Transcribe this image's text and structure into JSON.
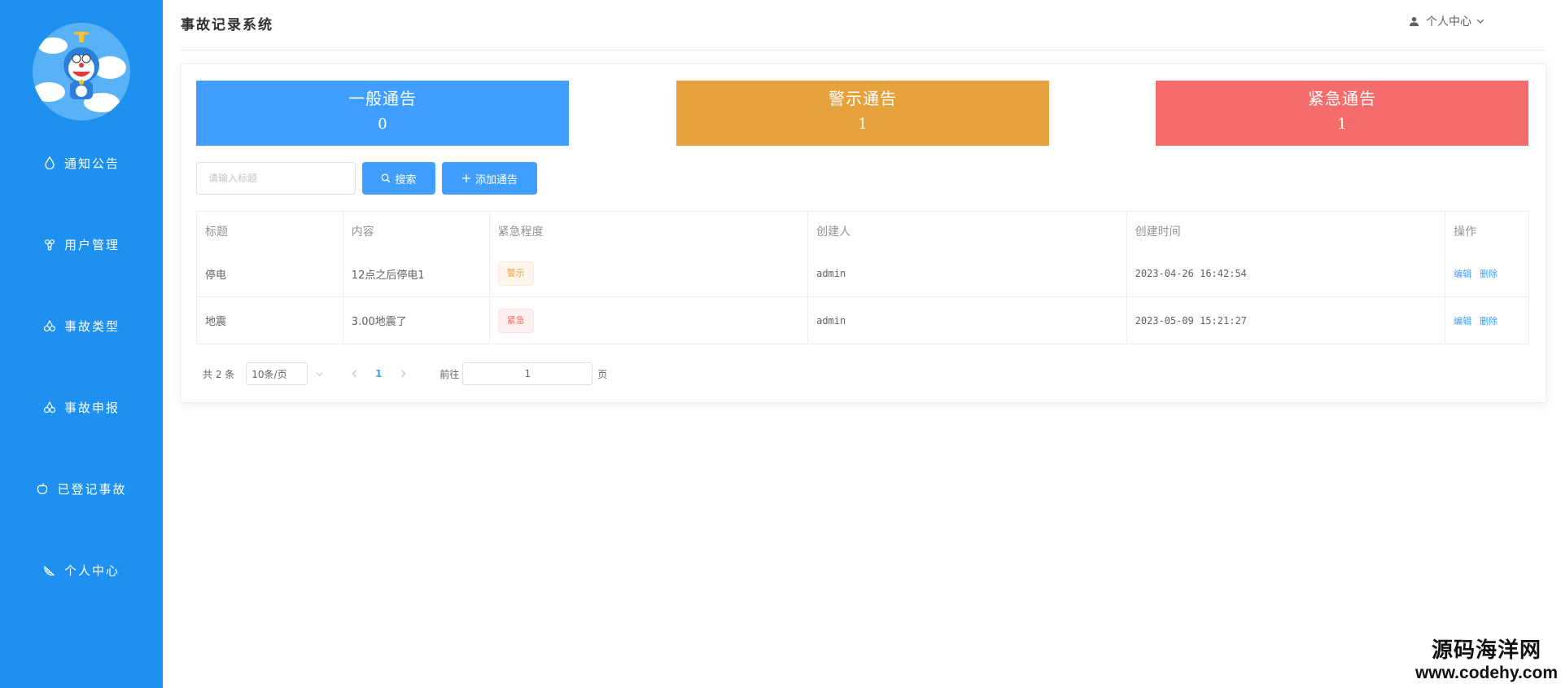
{
  "header": {
    "title": "事故记录系统",
    "user_menu": "个人中心"
  },
  "sidebar": {
    "items": [
      {
        "label": "通知公告",
        "icon": "drop-icon"
      },
      {
        "label": "用户管理",
        "icon": "grapes-icon"
      },
      {
        "label": "事故类型",
        "icon": "cherry-icon"
      },
      {
        "label": "事故申报",
        "icon": "cherry-icon"
      },
      {
        "label": "已登记事故",
        "icon": "apple-icon"
      },
      {
        "label": "个人中心",
        "icon": "watermelon-icon"
      }
    ]
  },
  "stats": {
    "general": {
      "label": "一般通告",
      "count": "0",
      "color": "#409eff"
    },
    "warning": {
      "label": "警示通告",
      "count": "1",
      "color": "#e6a23c"
    },
    "urgent": {
      "label": "紧急通告",
      "count": "1",
      "color": "#f56c6c"
    }
  },
  "toolbar": {
    "search_placeholder": "请输入标题",
    "search_label": "搜索",
    "add_label": "添加通告"
  },
  "table": {
    "columns": [
      "标题",
      "内容",
      "紧急程度",
      "创建人",
      "创建时间",
      "操作"
    ],
    "rows": [
      {
        "title": "停电",
        "content": "12点之后停电1",
        "level": "警示",
        "creator": "admin",
        "created": "2023-04-26 16:42:54"
      },
      {
        "title": "地震",
        "content": "3.00地震了",
        "level": "紧急",
        "creator": "admin",
        "created": "2023-05-09 15:21:27"
      }
    ],
    "edit_label": "编辑",
    "delete_label": "删除"
  },
  "pagination": {
    "total_text": "共 2 条",
    "page_size": "10条/页",
    "current_page": "1",
    "goto_label": "前往",
    "goto_value": "1",
    "page_unit": "页"
  },
  "watermark": {
    "name": "源码海洋网",
    "url": "www.codehy.com"
  }
}
